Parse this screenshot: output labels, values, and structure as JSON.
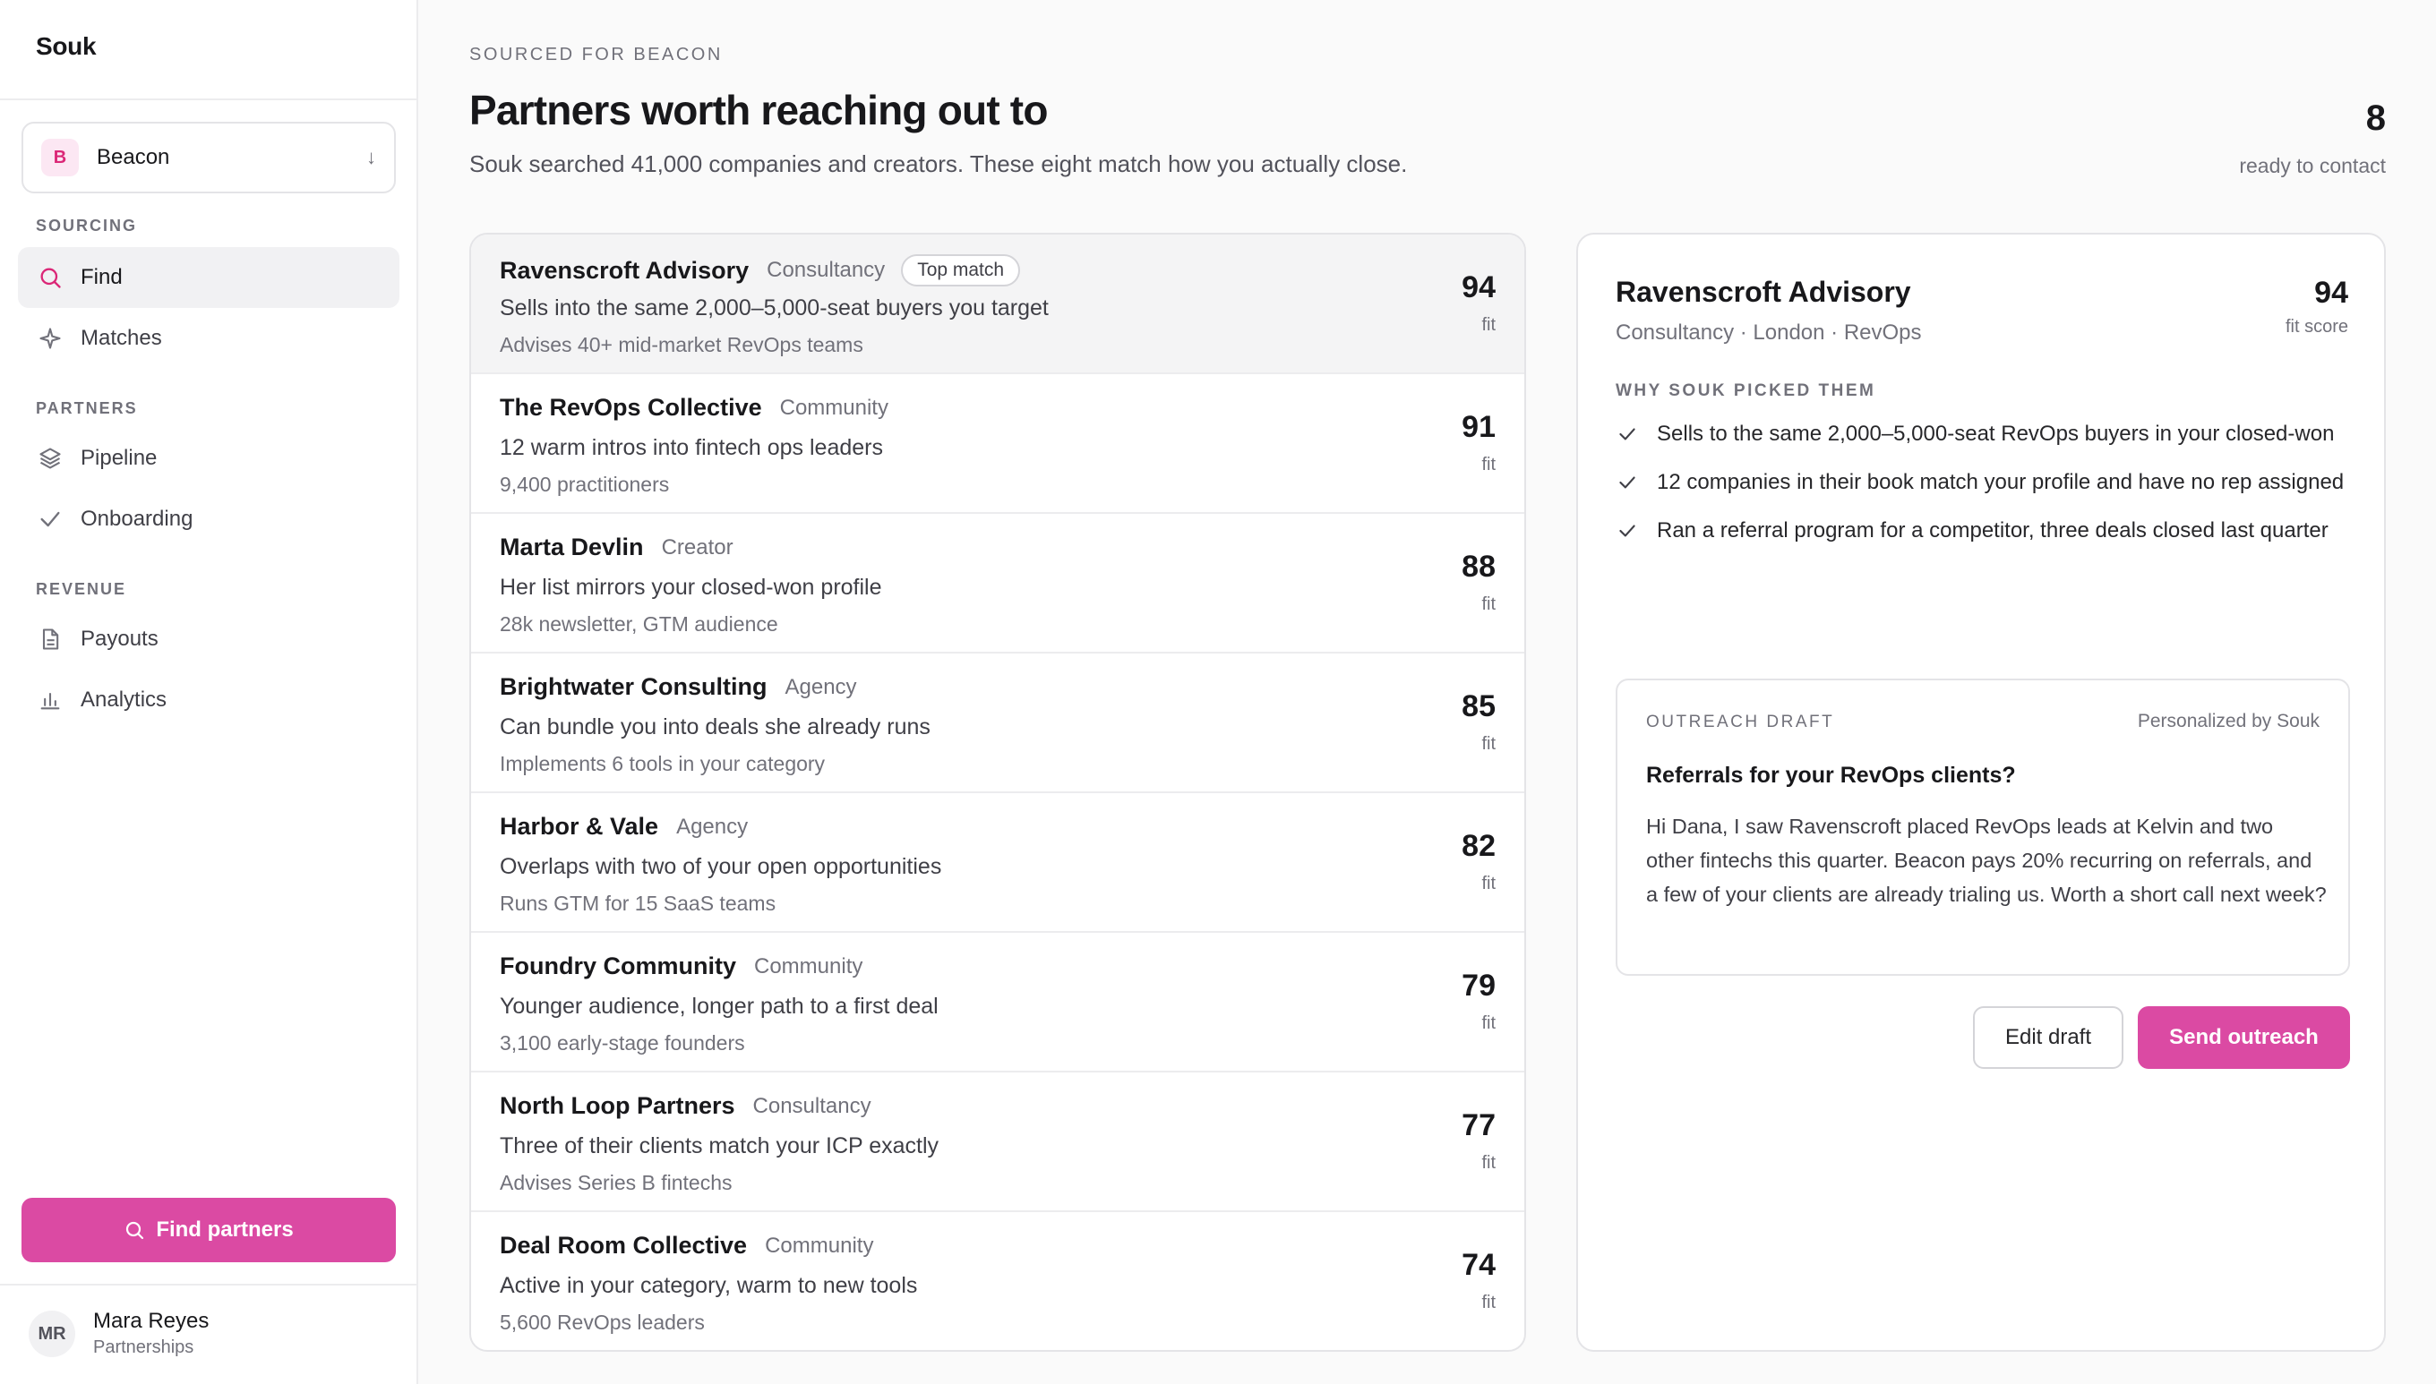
{
  "app": {
    "name": "Souk"
  },
  "workspace": {
    "badge": "B",
    "name": "Beacon",
    "arrow": "↓"
  },
  "nav": {
    "sections": [
      {
        "title": "SOURCING",
        "items": [
          {
            "label": "Find",
            "icon": "search-icon",
            "active": true
          },
          {
            "label": "Matches",
            "icon": "sparkle-icon"
          }
        ]
      },
      {
        "title": "PARTNERS",
        "items": [
          {
            "label": "Pipeline",
            "icon": "layers-icon"
          },
          {
            "label": "Onboarding",
            "icon": "check-icon"
          }
        ]
      },
      {
        "title": "REVENUE",
        "items": [
          {
            "label": "Payouts",
            "icon": "document-icon"
          },
          {
            "label": "Analytics",
            "icon": "bar-chart-icon"
          }
        ]
      }
    ],
    "cta_label": "Find partners"
  },
  "user": {
    "initials": "MR",
    "name": "Mara Reyes",
    "role": "Partnerships"
  },
  "header": {
    "eyebrow": "SOURCED FOR BEACON",
    "title": "Partners worth reaching out to",
    "subtitle": "Souk searched 41,000 companies and creators. These eight match how you actually close.",
    "count": "8",
    "count_label": "ready to contact"
  },
  "partners": [
    {
      "name": "Ravenscroft Advisory",
      "type": "Consultancy",
      "badge": "Top match",
      "reason": "Sells into the same 2,000–5,000-seat buyers you target",
      "detail": "Advises 40+ mid-market RevOps teams",
      "score": "94",
      "fit": "fit"
    },
    {
      "name": "The RevOps Collective",
      "type": "Community",
      "reason": "12 warm intros into fintech ops leaders",
      "detail": "9,400 practitioners",
      "score": "91",
      "fit": "fit"
    },
    {
      "name": "Marta Devlin",
      "type": "Creator",
      "reason": "Her list mirrors your closed-won profile",
      "detail": "28k newsletter, GTM audience",
      "score": "88",
      "fit": "fit"
    },
    {
      "name": "Brightwater Consulting",
      "type": "Agency",
      "reason": "Can bundle you into deals she already runs",
      "detail": "Implements 6 tools in your category",
      "score": "85",
      "fit": "fit"
    },
    {
      "name": "Harbor & Vale",
      "type": "Agency",
      "reason": "Overlaps with two of your open opportunities",
      "detail": "Runs GTM for 15 SaaS teams",
      "score": "82",
      "fit": "fit"
    },
    {
      "name": "Foundry Community",
      "type": "Community",
      "reason": "Younger audience, longer path to a first deal",
      "detail": "3,100 early-stage founders",
      "score": "79",
      "fit": "fit"
    },
    {
      "name": "North Loop Partners",
      "type": "Consultancy",
      "reason": "Three of their clients match your ICP exactly",
      "detail": "Advises Series B fintechs",
      "score": "77",
      "fit": "fit"
    },
    {
      "name": "Deal Room Collective",
      "type": "Community",
      "reason": "Active in your category, warm to new tools",
      "detail": "5,600 RevOps leaders",
      "score": "74",
      "fit": "fit"
    }
  ],
  "detail": {
    "name": "Ravenscroft Advisory",
    "meta": "Consultancy · London · RevOps",
    "score": "94",
    "score_label": "fit score",
    "why_title": "WHY SOUK PICKED THEM",
    "reasons": [
      "Sells to the same 2,000–5,000-seat RevOps buyers in your closed-won",
      "12 companies in their book match your profile and have no rep assigned",
      "Ran a referral program for a competitor, three deals closed last quarter"
    ],
    "draft": {
      "eyebrow": "OUTREACH DRAFT",
      "by": "Personalized by Souk",
      "subject": "Referrals for your RevOps clients?",
      "body": "Hi Dana, I saw Ravenscroft placed RevOps leads at Kelvin and two other fintechs this quarter. Beacon pays 20% recurring on referrals, and a few of your clients are already trialing us. Worth a short call next week?"
    },
    "edit_label": "Edit draft",
    "send_label": "Send outreach"
  },
  "colors": {
    "accent": "#db4aa3",
    "badge_bg": "#fce7f3",
    "badge_fg": "#db2777"
  }
}
